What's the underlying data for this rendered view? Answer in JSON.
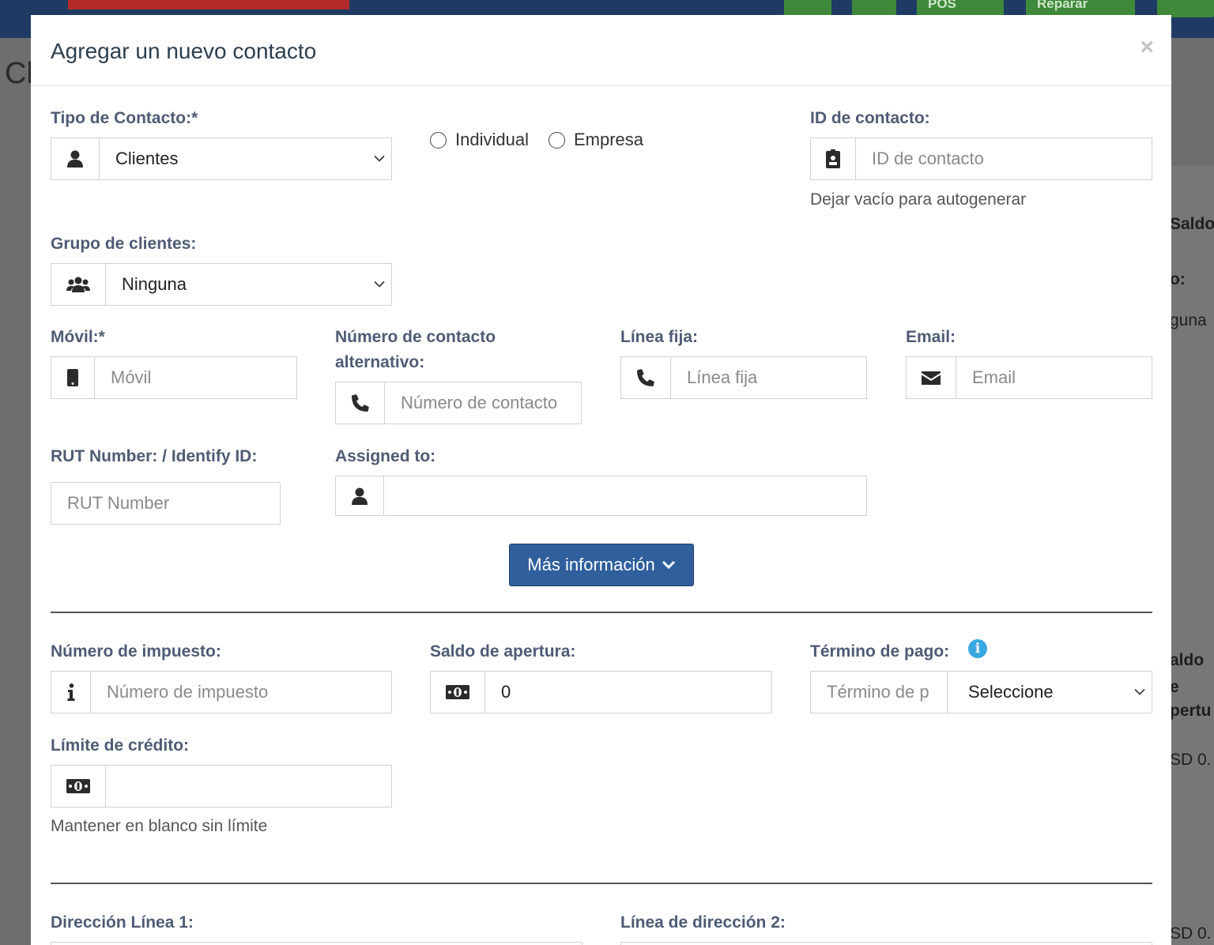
{
  "background": {
    "topbar_buttons": [
      "POS",
      "Reparar"
    ],
    "page_title_fragment": "Cl",
    "side_fragments": [
      "Saldo",
      "o:",
      "guna",
      "aldo",
      "e",
      "pertu",
      "SD 0.",
      "SD 0."
    ]
  },
  "modal": {
    "title": "Agregar un nuevo contacto",
    "close_label": "×"
  },
  "contact_type": {
    "label": "Tipo de Contacto:*",
    "value": "Clientes",
    "options": [
      "Individual",
      "Empresa"
    ]
  },
  "contact_id": {
    "label": "ID de contacto:",
    "placeholder": "ID de contacto",
    "help": "Dejar vacío para autogenerar"
  },
  "customer_group": {
    "label": "Grupo de clientes:",
    "value": "Ninguna"
  },
  "mobile": {
    "label": "Móvil:*",
    "placeholder": "Móvil"
  },
  "alt_contact": {
    "label_line1": "Número de contacto",
    "label_line2": "alternativo:",
    "placeholder": "Número de contacto"
  },
  "landline": {
    "label": "Línea fija:",
    "placeholder": "Línea fija"
  },
  "email": {
    "label": "Email:",
    "placeholder": "Email"
  },
  "rut": {
    "label": "RUT Number: / Identify ID:",
    "placeholder": "RUT Number"
  },
  "assigned": {
    "label": "Assigned to:",
    "value": ""
  },
  "more_button": {
    "label": "Más información"
  },
  "tax_number": {
    "label": "Número de impuesto:",
    "placeholder": "Número de impuesto"
  },
  "opening_balance": {
    "label": "Saldo de apertura:",
    "value": "0"
  },
  "pay_term": {
    "label": "Término de pago:",
    "placeholder": "Término de p",
    "select_value": "Seleccione"
  },
  "credit_limit": {
    "label": "Límite de crédito:",
    "value": "",
    "help": "Mantener en blanco sin límite"
  },
  "address": {
    "line1_label": "Dirección Línea 1:",
    "line2_label": "Línea de dirección 2:"
  },
  "colors": {
    "primary_button": "#2f5f9c",
    "label_color": "#4f5b75",
    "info_icon": "#3aa8e0"
  }
}
